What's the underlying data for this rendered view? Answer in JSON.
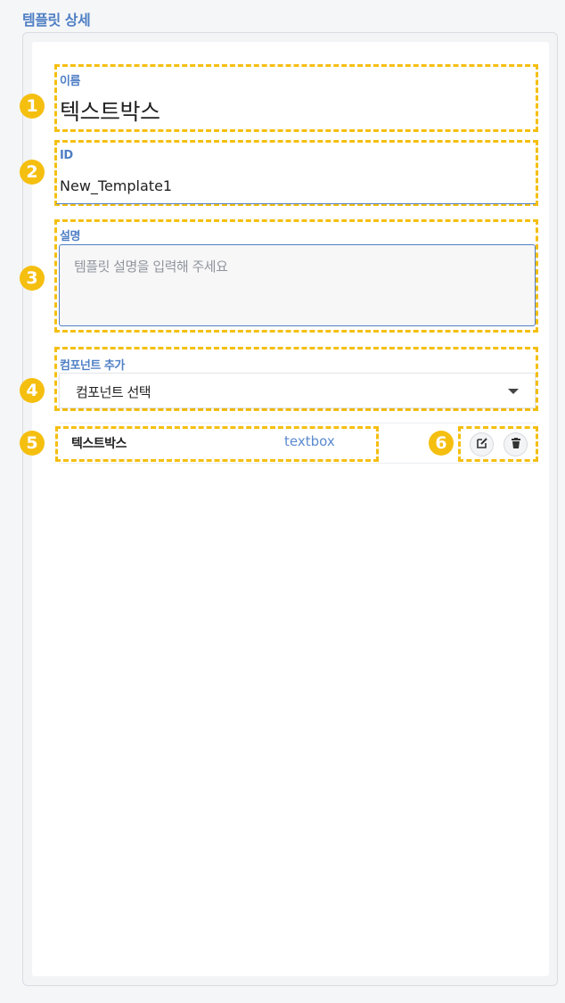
{
  "header": {
    "title": "템플릿 상세"
  },
  "badges": [
    "1",
    "2",
    "3",
    "4",
    "5",
    "6"
  ],
  "name_field": {
    "label": "이름",
    "value": "텍스트박스"
  },
  "id_field": {
    "label": "ID",
    "value": "New_Template1"
  },
  "description_field": {
    "label": "설명",
    "placeholder": "템플릿 설명을 입력해 주세요",
    "value": ""
  },
  "component_add": {
    "label": "컴포넌트 추가",
    "selected": "컴포넌트 선택"
  },
  "components": [
    {
      "name": "텍스트박스",
      "type": "textbox"
    }
  ],
  "icons": {
    "edit": "edit-icon",
    "delete": "trash-icon"
  },
  "colors": {
    "accent": "#4f7fc4",
    "highlight": "#f5bf10"
  }
}
